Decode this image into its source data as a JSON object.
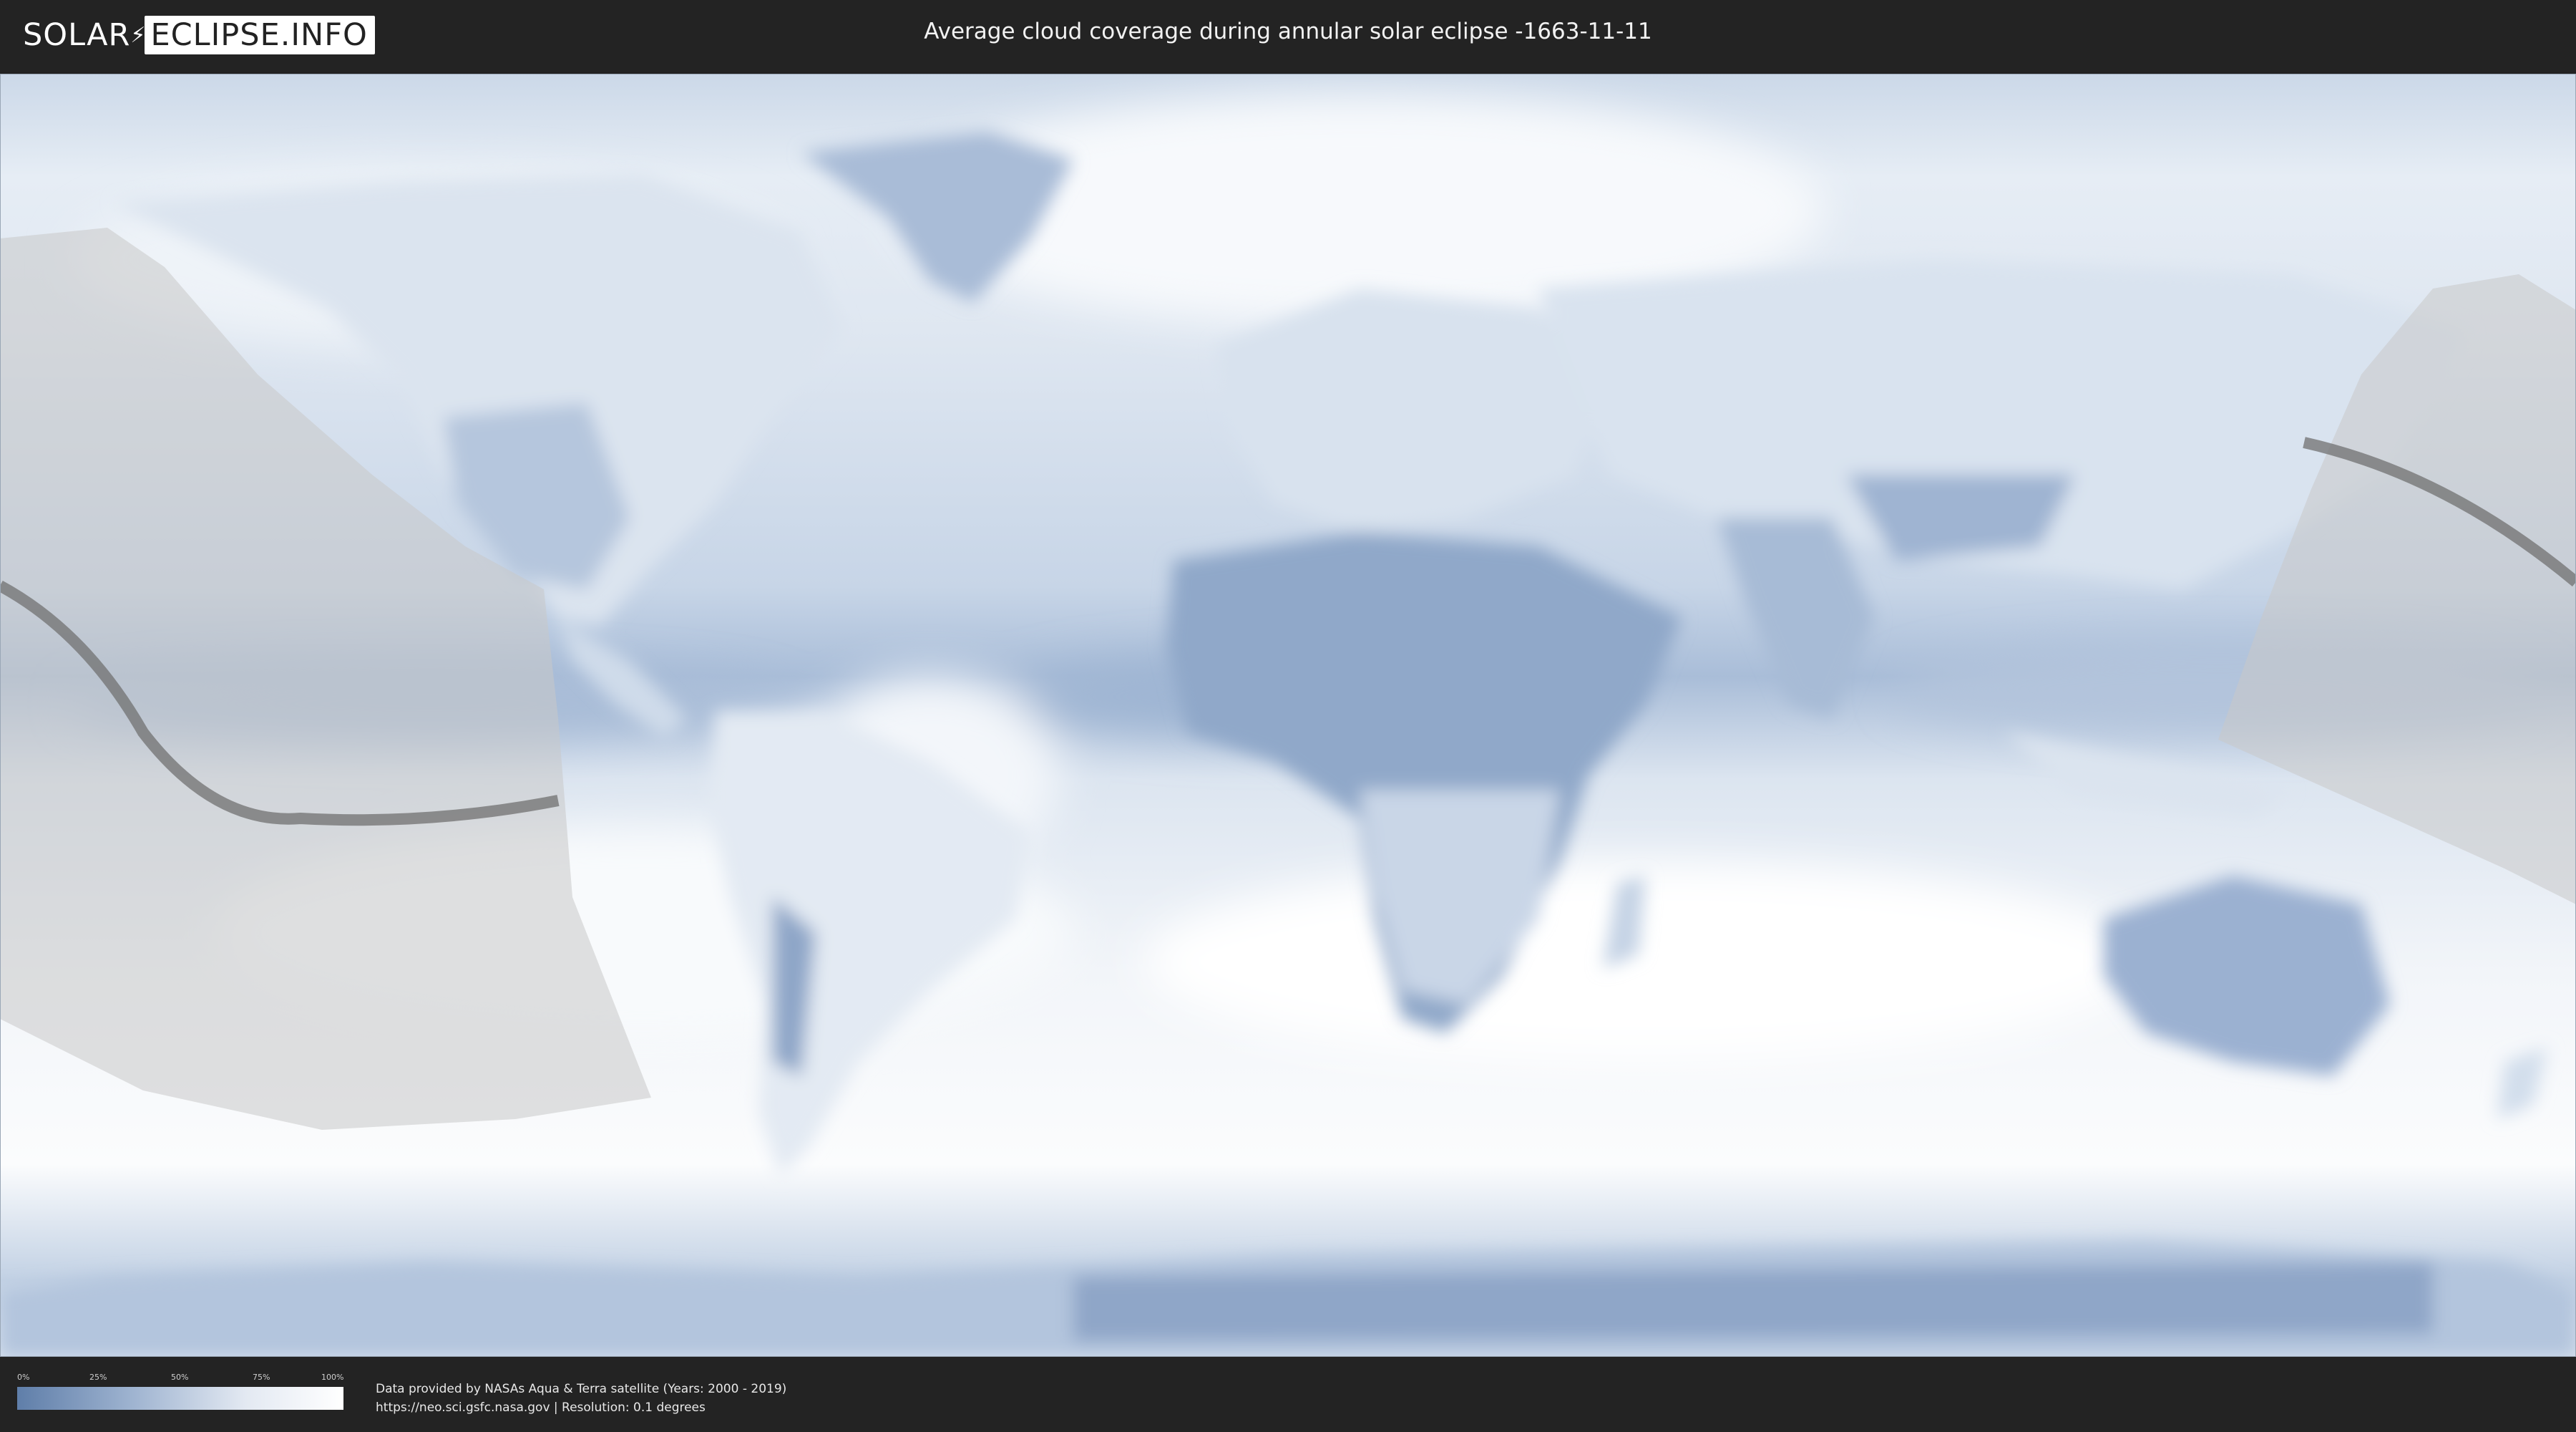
{
  "header": {
    "logo_left": "SOLAR",
    "logo_right": "ECLIPSE.INFO",
    "title": "Average cloud coverage during annular solar eclipse -1663-11-11"
  },
  "map": {
    "land_color": "#e4ebf4",
    "clear_sky_color": "#5f7ea9",
    "cloud_color": "#ffffff",
    "eclipse_zone_color": "#c9c9c9",
    "central_path_color": "#707070"
  },
  "legend": {
    "ticks": [
      "0%",
      "25%",
      "50%",
      "75%",
      "100%"
    ],
    "colors": [
      "#5f7ea9",
      "#ffffff"
    ]
  },
  "footer": {
    "credit_line1": "Data provided by NASAs Aqua & Terra satellite (Years: 2000 - 2019)",
    "credit_line2": "https://neo.sci.gsfc.nasa.gov | Resolution: 0.1 degrees"
  }
}
